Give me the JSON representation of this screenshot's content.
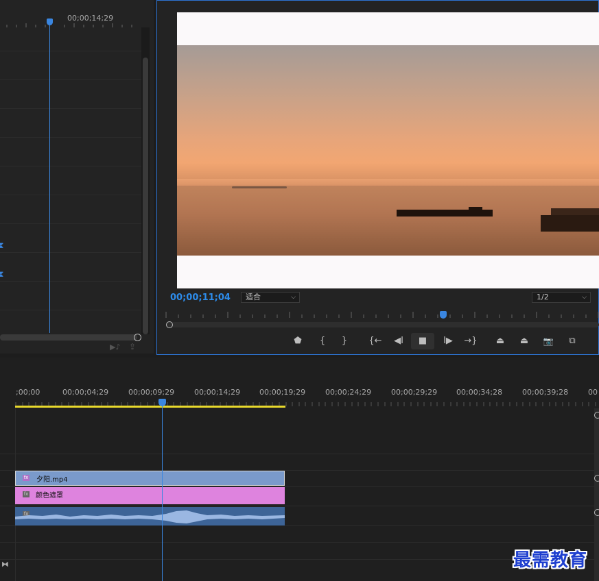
{
  "effect_controls": {
    "timecode": "00;00;14;29",
    "keyframe_marker_1": "⧗",
    "keyframe_marker_2": "⧗",
    "footer_icons": [
      "play-audio-icon",
      "export-icon"
    ]
  },
  "program_monitor": {
    "timecode": "00;00;11;04",
    "fit_dropdown": "适合",
    "resolution_dropdown": "1/2",
    "controls": [
      {
        "name": "add-marker-button",
        "glyph": "⬟"
      },
      {
        "name": "mark-in-button",
        "glyph": "{"
      },
      {
        "name": "mark-out-button",
        "glyph": "}"
      },
      {
        "name": "go-to-in-button",
        "glyph": "{←"
      },
      {
        "name": "step-back-button",
        "glyph": "◀I"
      },
      {
        "name": "stop-button",
        "glyph": "■"
      },
      {
        "name": "step-forward-button",
        "glyph": "I▶"
      },
      {
        "name": "go-to-out-button",
        "glyph": "→}"
      },
      {
        "name": "lift-button",
        "glyph": "⏏"
      },
      {
        "name": "extract-button",
        "glyph": "⏏"
      },
      {
        "name": "export-frame-button",
        "glyph": "📷"
      },
      {
        "name": "comparison-view-button",
        "glyph": "⧉"
      }
    ]
  },
  "timeline": {
    "ruler_labels": [
      ";00;00",
      "00;00;04;29",
      "00;00;09;29",
      "00;00;14;29",
      "00;00;19;29",
      "00;00;24;29",
      "00;00;29;29",
      "00;00;34;28",
      "00;00;39;28",
      "00"
    ],
    "clips": {
      "video_clip": "夕阳.mp4",
      "matte_clip": "颜色遮罩",
      "fx_badge": "fx"
    },
    "colors": {
      "video_clip": "#7a9acb",
      "matte_clip": "#de83de",
      "audio_clip": "#3d6497",
      "playhead": "#3a86e0",
      "work_area": "#e8d92c"
    }
  },
  "watermark": "最需教育"
}
